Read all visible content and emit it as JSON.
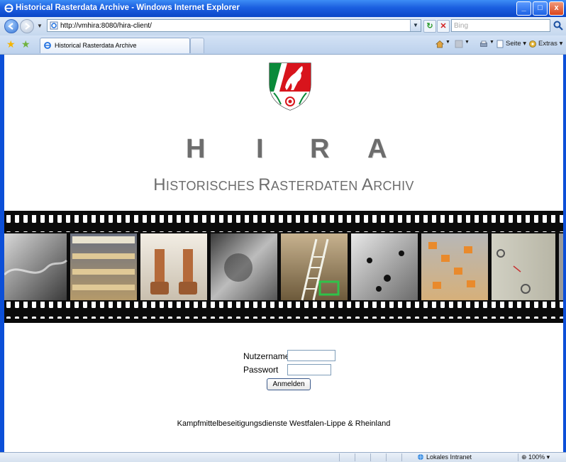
{
  "window": {
    "title": "Historical Rasterdata Archive - Windows Internet Explorer",
    "buttons": {
      "minimize": "_",
      "maximize": "□",
      "close": "x"
    }
  },
  "addressbar": {
    "url": "http://vmhira:8080/hira-client/",
    "search_placeholder": "Bing"
  },
  "tabs": [
    {
      "label": "Historical Rasterdata Archive"
    }
  ],
  "commandbar": {
    "page_label": "Seite",
    "tools_label": "Extras"
  },
  "page": {
    "letters": [
      "H",
      "I",
      "R",
      "A"
    ],
    "subtitle": {
      "w1_initial": "H",
      "w1_rest": "ISTORISCHES",
      "w2_initial": "R",
      "w2_rest": "ASTERDATEN",
      "w3_initial": "A",
      "w3_rest": "RCHIV"
    },
    "login": {
      "username_label": "Nutzername",
      "password_label": "Passwort",
      "username_value": "",
      "password_value": "",
      "submit_label": "Anmelden"
    },
    "footer": "Kampfmittelbeseitigungsdienste Westfalen-Lippe & Rheinland"
  },
  "statusbar": {
    "zone": "Lokales Intranet",
    "zoom": "100%"
  },
  "colors": {
    "xp_blue": "#0c4fd8",
    "logo_grey": "#6d6d6d",
    "crest_green": "#0a8a3a",
    "crest_red": "#d8141c"
  }
}
